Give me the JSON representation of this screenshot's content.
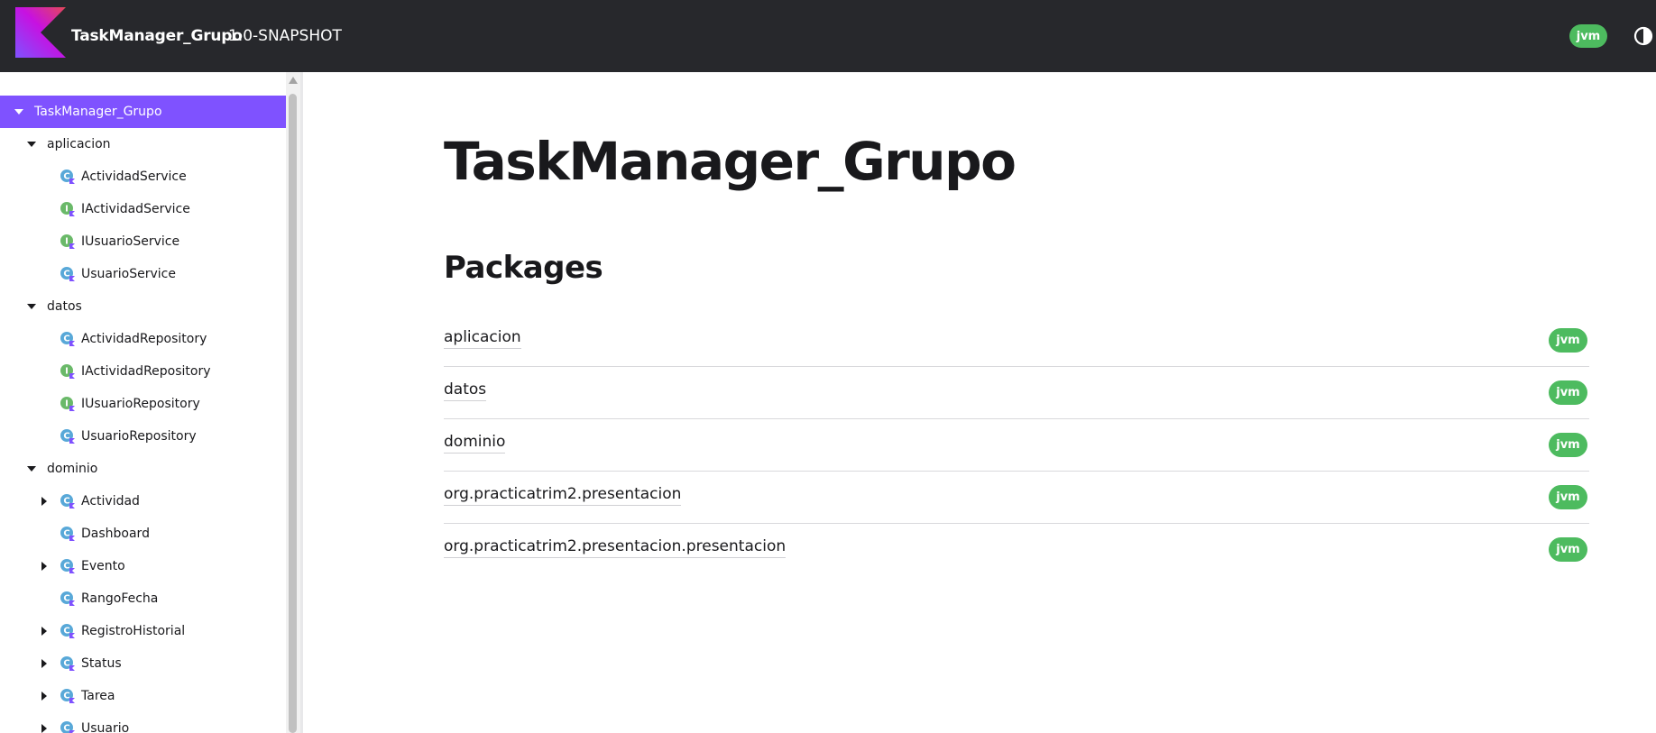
{
  "header": {
    "project_name": "TaskManager_Grupo",
    "version": "1.0-SNAPSHOT",
    "platform_badge": "jvm",
    "logo_icon": "kotlin-logo-icon",
    "theme_toggle_icon": "theme-toggle-icon"
  },
  "sidebar": {
    "items": [
      {
        "label": "TaskManager_Grupo",
        "level": 0,
        "expanded": true,
        "selected": true,
        "icon": null
      },
      {
        "label": "aplicacion",
        "level": 1,
        "expanded": true,
        "icon": null
      },
      {
        "label": "ActividadService",
        "level": 2,
        "icon": "class-icon"
      },
      {
        "label": "IActividadService",
        "level": 2,
        "icon": "interface-icon"
      },
      {
        "label": "IUsuarioService",
        "level": 2,
        "icon": "interface-icon"
      },
      {
        "label": "UsuarioService",
        "level": 2,
        "icon": "class-icon"
      },
      {
        "label": "datos",
        "level": 1,
        "expanded": true,
        "icon": null
      },
      {
        "label": "ActividadRepository",
        "level": 2,
        "icon": "class-icon"
      },
      {
        "label": "IActividadRepository",
        "level": 2,
        "icon": "interface-icon"
      },
      {
        "label": "IUsuarioRepository",
        "level": 2,
        "icon": "interface-icon"
      },
      {
        "label": "UsuarioRepository",
        "level": 2,
        "icon": "class-icon"
      },
      {
        "label": "dominio",
        "level": 1,
        "expanded": true,
        "icon": null
      },
      {
        "label": "Actividad",
        "level": 2,
        "collapsible": true,
        "icon": "class-icon"
      },
      {
        "label": "Dashboard",
        "level": 2,
        "icon": "class-icon"
      },
      {
        "label": "Evento",
        "level": 2,
        "collapsible": true,
        "icon": "class-icon"
      },
      {
        "label": "RangoFecha",
        "level": 2,
        "icon": "class-icon"
      },
      {
        "label": "RegistroHistorial",
        "level": 2,
        "collapsible": true,
        "icon": "class-icon"
      },
      {
        "label": "Status",
        "level": 2,
        "collapsible": true,
        "icon": "class-icon"
      },
      {
        "label": "Tarea",
        "level": 2,
        "collapsible": true,
        "icon": "class-icon"
      },
      {
        "label": "Usuario",
        "level": 2,
        "collapsible": true,
        "icon": "class-icon"
      }
    ]
  },
  "main": {
    "title": "TaskManager_Grupo",
    "packages_heading": "Packages",
    "packages": [
      {
        "name": "aplicacion",
        "platform": "jvm"
      },
      {
        "name": "datos",
        "platform": "jvm"
      },
      {
        "name": "dominio",
        "platform": "jvm"
      },
      {
        "name": "org.practicatrim2.presentacion",
        "platform": "jvm"
      },
      {
        "name": "org.practicatrim2.presentacion.presentacion",
        "platform": "jvm"
      }
    ]
  },
  "colors": {
    "header_bg": "#27282c",
    "accent": "#7f52ff",
    "platform_badge": "#4dbb5f"
  }
}
